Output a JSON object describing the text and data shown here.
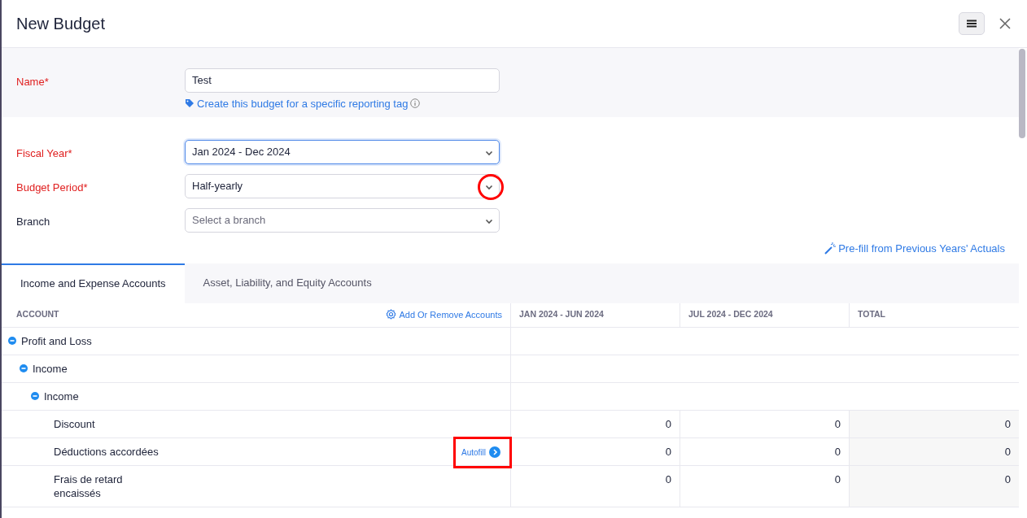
{
  "header": {
    "title": "New Budget"
  },
  "top_fields": [
    {
      "kind": "text",
      "label": "Name*",
      "required": true,
      "value": "Test",
      "focused": false
    }
  ],
  "tag_link": {
    "text": "Create this budget for a specific reporting tag"
  },
  "fields": [
    {
      "kind": "select",
      "label": "Fiscal Year*",
      "required": true,
      "value": "Jan 2024 - Dec 2024",
      "focused": true
    },
    {
      "kind": "select",
      "label": "Budget Period*",
      "required": true,
      "value": "Half-yearly",
      "focused": false
    },
    {
      "kind": "select",
      "label": "Branch",
      "required": false,
      "placeholder": "Select a branch",
      "focused": false
    }
  ],
  "prefill_link": {
    "text": "Pre-fill from Previous Years' Actuals"
  },
  "tabs": [
    {
      "label": "Income and Expense Accounts",
      "selected": true
    },
    {
      "label": "Asset, Liability, and Equity Accounts",
      "selected": false
    }
  ],
  "table": {
    "columns": [
      "ACCOUNT",
      "JAN 2024 - JUN 2024",
      "JUL 2024 - DEC 2024",
      "TOTAL"
    ],
    "add_accounts_link": "Add Or Remove Accounts",
    "rows": [
      {
        "name": "Profit and Loss",
        "expanded": true,
        "children": [
          {
            "name": "Income",
            "expanded": true,
            "children": [
              {
                "name": "Income",
                "expanded": true,
                "children": [
                  {
                    "name": "Discount",
                    "values": [
                      "0",
                      "0",
                      "0"
                    ]
                  },
                  {
                    "name": "Déductions accordées",
                    "autofill": "Autofill",
                    "values": [
                      "0",
                      "0",
                      "0"
                    ]
                  },
                  {
                    "name": "Frais de retard encaissés",
                    "values": [
                      "0",
                      "0",
                      "0"
                    ]
                  }
                ]
              }
            ]
          }
        ]
      }
    ]
  }
}
